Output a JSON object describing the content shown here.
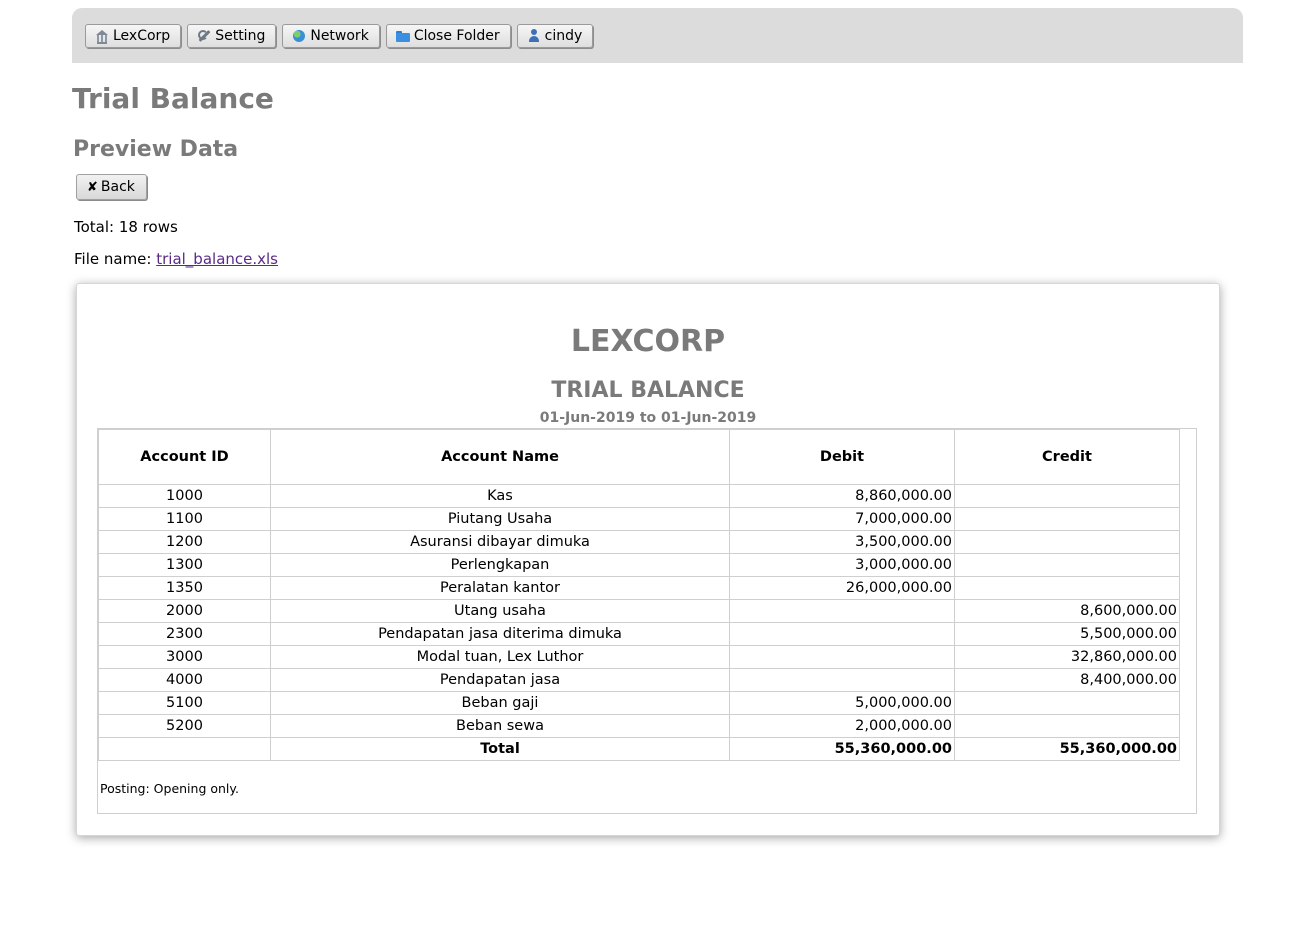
{
  "toolbar": {
    "buttons": [
      {
        "label": "LexCorp",
        "icon": "bank-icon"
      },
      {
        "label": "Setting",
        "icon": "wrench-icon"
      },
      {
        "label": "Network",
        "icon": "globe-icon"
      },
      {
        "label": "Close Folder",
        "icon": "folder-icon"
      },
      {
        "label": "cindy",
        "icon": "user-icon"
      }
    ]
  },
  "page": {
    "title": "Trial Balance",
    "subtitle": "Preview Data",
    "back_label": "Back",
    "total_text": "Total: 18 rows",
    "file_label": "File name: ",
    "file_name": "trial_balance.xls"
  },
  "report": {
    "company": "LEXCORP",
    "title": "TRIAL BALANCE",
    "period": "01-Jun-2019 to 01-Jun-2019",
    "headers": {
      "id": "Account ID",
      "name": "Account Name",
      "debit": "Debit",
      "credit": "Credit"
    },
    "rows": [
      {
        "id": "1000",
        "name": "Kas",
        "debit": "8,860,000.00",
        "credit": ""
      },
      {
        "id": "1100",
        "name": "Piutang Usaha",
        "debit": "7,000,000.00",
        "credit": ""
      },
      {
        "id": "1200",
        "name": "Asuransi dibayar dimuka",
        "debit": "3,500,000.00",
        "credit": ""
      },
      {
        "id": "1300",
        "name": "Perlengkapan",
        "debit": "3,000,000.00",
        "credit": ""
      },
      {
        "id": "1350",
        "name": "Peralatan kantor",
        "debit": "26,000,000.00",
        "credit": ""
      },
      {
        "id": "2000",
        "name": "Utang usaha",
        "debit": "",
        "credit": "8,600,000.00"
      },
      {
        "id": "2300",
        "name": "Pendapatan jasa diterima dimuka",
        "debit": "",
        "credit": "5,500,000.00"
      },
      {
        "id": "3000",
        "name": "Modal tuan, Lex Luthor",
        "debit": "",
        "credit": "32,860,000.00"
      },
      {
        "id": "4000",
        "name": "Pendapatan jasa",
        "debit": "",
        "credit": "8,400,000.00"
      },
      {
        "id": "5100",
        "name": "Beban gaji",
        "debit": "5,000,000.00",
        "credit": ""
      },
      {
        "id": "5200",
        "name": "Beban sewa",
        "debit": "2,000,000.00",
        "credit": ""
      }
    ],
    "total": {
      "label": "Total",
      "debit": "55,360,000.00",
      "credit": "55,360,000.00"
    },
    "posting_note": "Posting: Opening only."
  }
}
